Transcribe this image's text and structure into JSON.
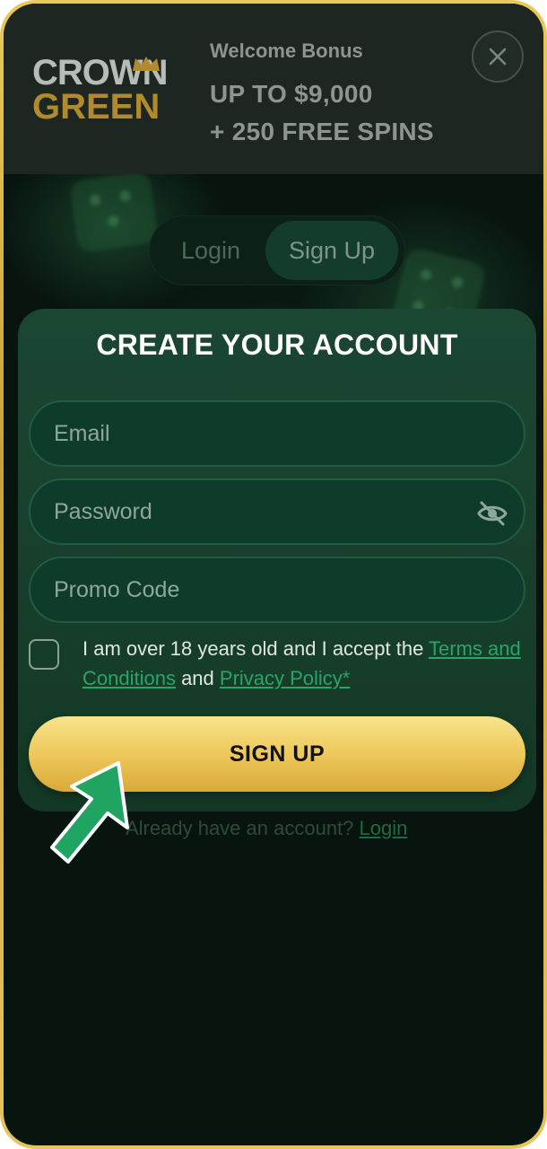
{
  "header": {
    "logo": {
      "line1": "CROWN",
      "line2": "GREEN"
    },
    "bonus_label": "Welcome Bonus",
    "bonus_line1": "UP TO $9,000",
    "bonus_line2": "+ 250 FREE SPINS",
    "close_icon": "close-icon"
  },
  "tabs": [
    {
      "label": "Login",
      "active": false
    },
    {
      "label": "Sign Up",
      "active": true
    }
  ],
  "form": {
    "title": "CREATE YOUR ACCOUNT",
    "email_placeholder": "Email",
    "password_placeholder": "Password",
    "password_icon": "eye-slash-icon",
    "promo_placeholder": "Promo Code",
    "consent_text": "I am over 18 years old and I accept the ",
    "terms_link": "Terms and Conditions",
    "and_text": " and ",
    "privacy_link": "Privacy Policy*",
    "submit_label": "SIGN UP"
  },
  "footer": {
    "already_text": "Already have an account? ",
    "login_link": "Login"
  },
  "colors": {
    "background": "#08150f",
    "card": "#1b4633",
    "accent_gold": "#edc85a",
    "link_green": "#29a567",
    "pointer_green": "#1fa462"
  }
}
